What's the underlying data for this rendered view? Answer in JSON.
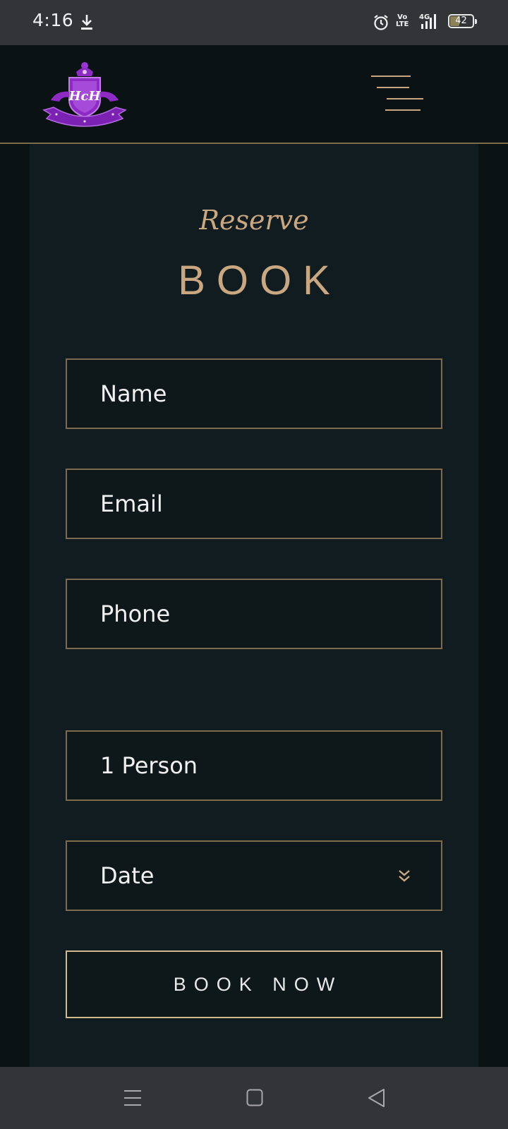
{
  "status_bar": {
    "time": "4:16",
    "volte_top": "Vo",
    "volte_bottom": "LTE",
    "network": "4G",
    "battery_level": "42",
    "battery_fraction": 0.42,
    "icons": [
      "download-icon",
      "alarm-icon",
      "volte-icon",
      "signal-icon",
      "battery-icon"
    ]
  },
  "header": {
    "logo_text": "HcH",
    "logo_icon": "crest-logo",
    "menu_icon": "hamburger-menu-icon"
  },
  "booking": {
    "subtitle": "Reserve",
    "title": "BOOK",
    "fields": {
      "name_placeholder": "Name",
      "email_placeholder": "Email",
      "phone_placeholder": "Phone",
      "persons_value": "1 Person",
      "date_placeholder": "Date"
    },
    "submit_label": "BOOK NOW"
  },
  "colors": {
    "accent_gold": "#c9a881",
    "border_gold": "#7e6a4d",
    "panel_bg": "#111c20",
    "page_bg": "#0b1213",
    "logo_purple": "#8e2bc4"
  },
  "nav_bar": {
    "icons": [
      "recent-apps-icon",
      "home-icon",
      "back-icon"
    ]
  }
}
